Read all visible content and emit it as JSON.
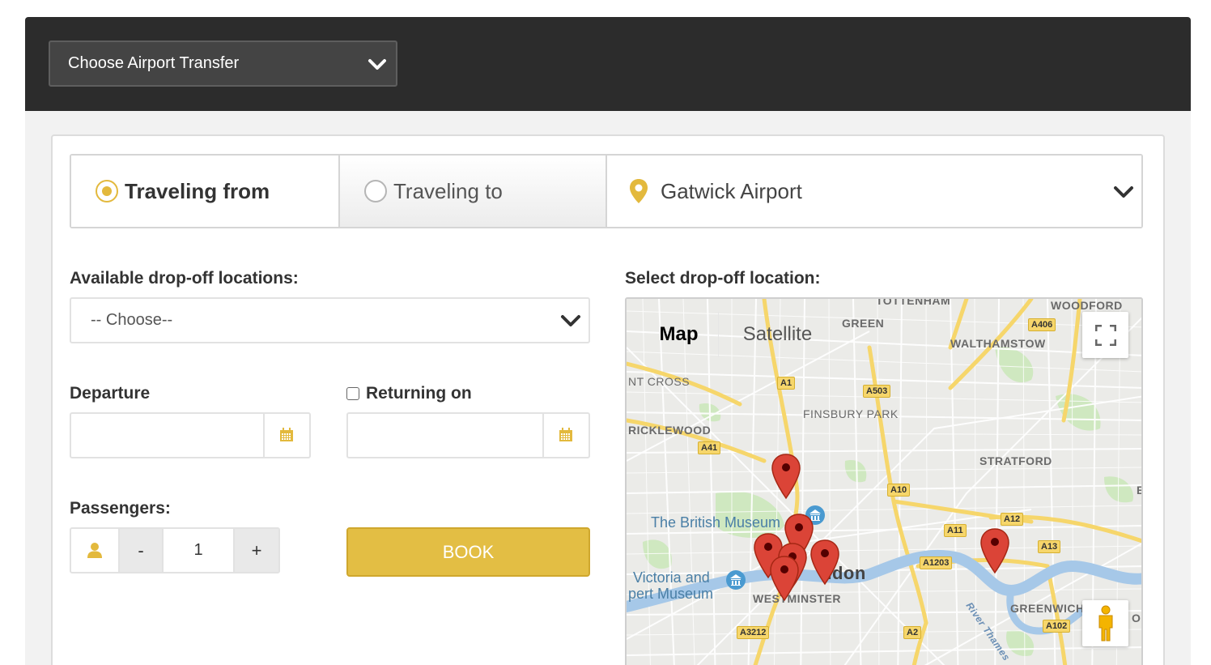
{
  "header": {
    "transfer_select_value": "Choose Airport Transfer"
  },
  "direction_tabs": {
    "from_label": "Traveling from",
    "to_label": "Traveling to",
    "location_value": "Gatwick Airport",
    "selected": "from"
  },
  "form": {
    "dropoff_label": "Available drop-off locations:",
    "dropoff_value": "-- Choose--",
    "departure_label": "Departure",
    "departure_value": "",
    "returning_label": "Returning on",
    "returning_checked": false,
    "returning_value": "",
    "passengers_label": "Passengers:",
    "passengers_minus": "-",
    "passengers_value": "1",
    "passengers_plus": "+",
    "book_label": "BOOK"
  },
  "map": {
    "title": "Select drop-off location:",
    "type_map": "Map",
    "type_satellite": "Satellite",
    "labels": {
      "tottenham": "TOTTENHAM",
      "woodford": "WOODFORD",
      "green": "GREEN",
      "walthamstow": "WALTHAMSTOW",
      "kings_cross": "NT CROSS",
      "finsbury_park": "FINSBURY PARK",
      "cricklewood": "RICKLEWOOD",
      "stratford": "STRATFORD",
      "e": "E",
      "westminster": "WESTMINSTER",
      "london": "ndon",
      "greenwich": "GREENWICH",
      "river_thames": "River Thames",
      "ol": "OI"
    },
    "pois": {
      "british_museum": "The British Museum",
      "va_line1": "Victoria and",
      "va_line2": "pert Museum"
    },
    "road_shields": {
      "a406": "A406",
      "a1": "A1",
      "a503": "A503",
      "a41": "A41",
      "a10": "A10",
      "a12": "A12",
      "a11": "A11",
      "a13": "A13",
      "a1203": "A1203",
      "a3212": "A3212",
      "a2": "A2",
      "a102": "A102"
    },
    "marker_color": "#db4437"
  },
  "colors": {
    "accent": "#e3b93d",
    "topbar": "#2c2c2c"
  }
}
